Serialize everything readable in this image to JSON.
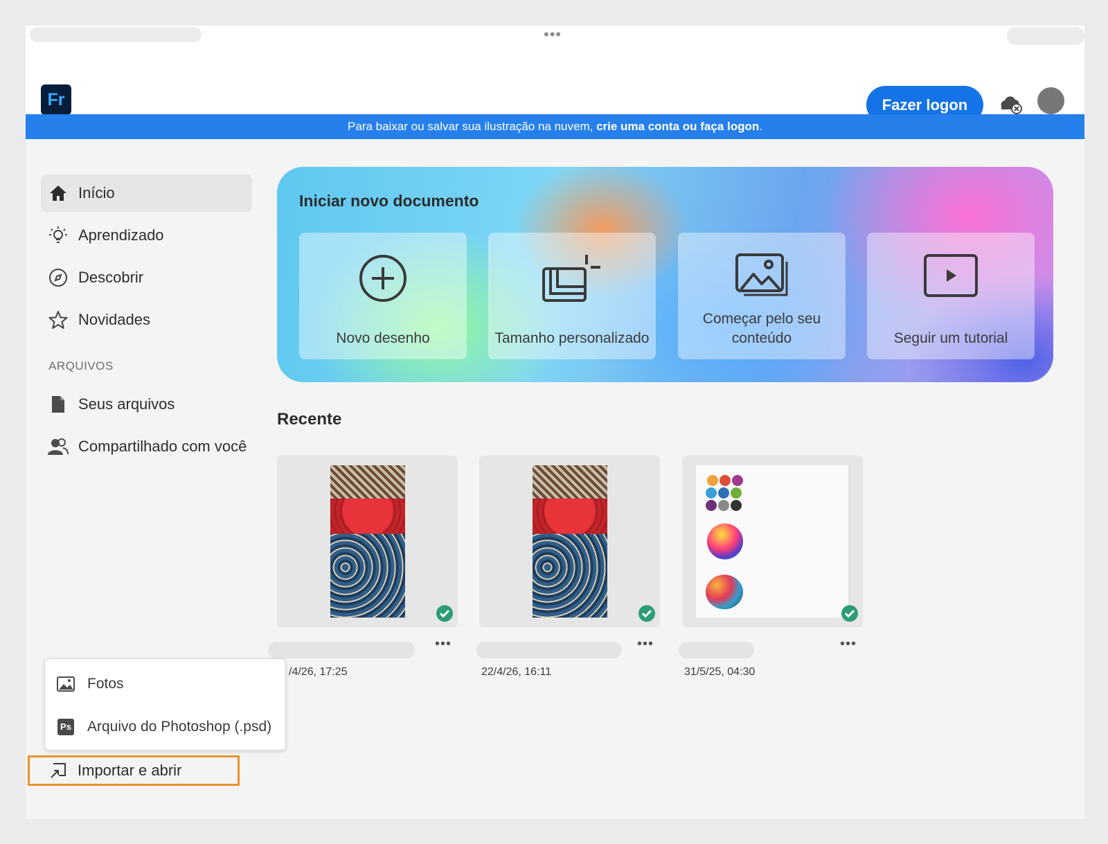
{
  "app": {
    "logo_text": "Fr",
    "brand_color": "#1473e6",
    "logo_bg": "#061e3a"
  },
  "header": {
    "login_label": "Fazer logon"
  },
  "banner": {
    "text": "Para baixar ou salvar sua ilustração na nuvem, ",
    "link": "crie uma conta ou faça logon",
    "suffix": "."
  },
  "sidebar": {
    "items": [
      {
        "label": "Início",
        "icon": "home-icon"
      },
      {
        "label": "Aprendizado",
        "icon": "lightbulb-icon"
      },
      {
        "label": "Descobrir",
        "icon": "compass-icon"
      },
      {
        "label": "Novidades",
        "icon": "star-icon"
      }
    ],
    "section_label": "ARQUIVOS",
    "file_items": [
      {
        "label": "Seus arquivos",
        "icon": "document-icon"
      },
      {
        "label": "Compartilhado com você",
        "icon": "people-icon"
      }
    ],
    "import_label": "Importar e abrir"
  },
  "hero": {
    "title": "Iniciar novo documento",
    "cards": [
      {
        "label": "Novo desenho",
        "icon": "plus-circle-icon"
      },
      {
        "label": "Tamanho personalizado",
        "icon": "custom-size-icon"
      },
      {
        "label": "Começar pelo seu conteúdo",
        "icon": "image-icon"
      },
      {
        "label": "Seguir um tutorial",
        "icon": "play-icon"
      }
    ]
  },
  "recent": {
    "title": "Recente",
    "files": [
      {
        "date": "/4/26, 17:25",
        "synced": true
      },
      {
        "date": "22/4/26, 16:11",
        "synced": true
      },
      {
        "date": "31/5/25, 04:30",
        "synced": true
      }
    ],
    "more_label": "•••"
  },
  "import_menu": {
    "items": [
      {
        "label": "Fotos",
        "icon": "photo-icon"
      },
      {
        "label": "Arquivo do Photoshop (.psd)",
        "icon": "photoshop-icon",
        "badge": "Ps"
      }
    ]
  }
}
